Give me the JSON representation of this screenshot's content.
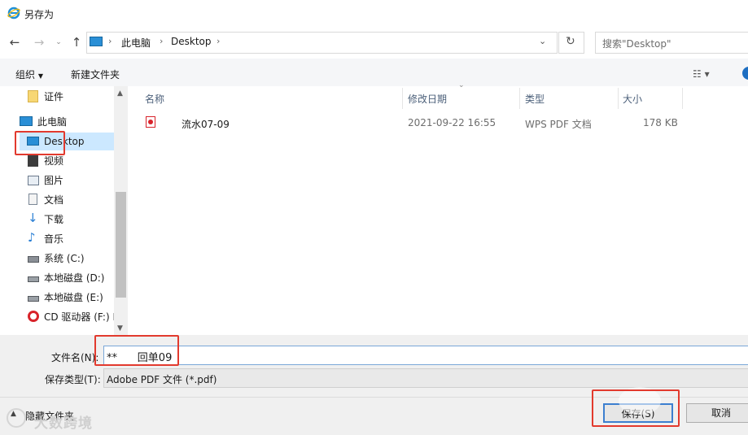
{
  "window": {
    "title": "另存为"
  },
  "address": {
    "segments": [
      "此电脑",
      "Desktop"
    ],
    "search_placeholder": "搜索\"Desktop\""
  },
  "toolbar": {
    "organize_label": "组织",
    "new_folder_label": "新建文件夹"
  },
  "nav": {
    "items": [
      {
        "label": "证件",
        "icon": "folder-icon"
      },
      {
        "label": "此电脑",
        "icon": "computer-icon"
      },
      {
        "label": "Desktop",
        "icon": "desktop-icon",
        "selected": true
      },
      {
        "label": "视频",
        "icon": "video-icon"
      },
      {
        "label": "图片",
        "icon": "pictures-icon"
      },
      {
        "label": "文档",
        "icon": "documents-icon"
      },
      {
        "label": "下载",
        "icon": "download-icon"
      },
      {
        "label": "音乐",
        "icon": "music-icon"
      },
      {
        "label": "系统 (C:)",
        "icon": "system-drive-icon"
      },
      {
        "label": "本地磁盘 (D:)",
        "icon": "drive-icon"
      },
      {
        "label": "本地磁盘 (E:)",
        "icon": "drive-icon"
      },
      {
        "label": "CD 驱动器 (F:) I",
        "icon": "cd-drive-icon"
      }
    ]
  },
  "list": {
    "columns": [
      "名称",
      "修改日期",
      "类型",
      "大小"
    ],
    "rows": [
      {
        "name": "流水07-09",
        "modified": "2021-09-22 16:55",
        "type": "WPS PDF 文档",
        "size": "178 KB"
      }
    ]
  },
  "form": {
    "filename_label": "文件名(N):",
    "filename_value": "**      回单09",
    "filetype_label": "保存类型(T):",
    "filetype_value": "Adobe PDF 文件 (*.pdf)"
  },
  "footer": {
    "hide_folders_label": "隐藏文件夹",
    "save_label": "保存(S)",
    "cancel_label": "取消",
    "watermark": "大数跨境"
  },
  "colors": {
    "highlight_red": "#e23a2e",
    "selection_blue": "#cce8ff",
    "header_text": "#4c607a"
  }
}
